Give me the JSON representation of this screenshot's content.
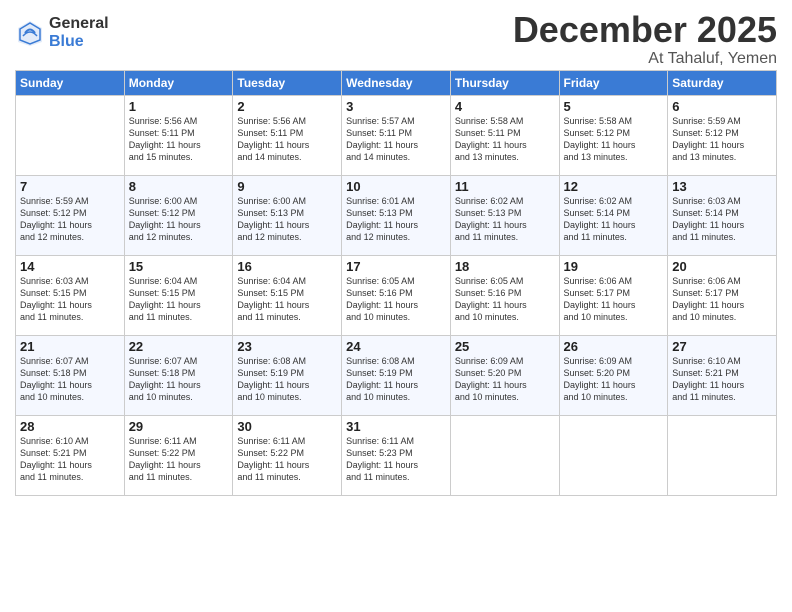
{
  "logo": {
    "general": "General",
    "blue": "Blue"
  },
  "title": "December 2025",
  "location": "At Tahaluf, Yemen",
  "days_of_week": [
    "Sunday",
    "Monday",
    "Tuesday",
    "Wednesday",
    "Thursday",
    "Friday",
    "Saturday"
  ],
  "weeks": [
    [
      {
        "day": "",
        "info": ""
      },
      {
        "day": "1",
        "info": "Sunrise: 5:56 AM\nSunset: 5:11 PM\nDaylight: 11 hours\nand 15 minutes."
      },
      {
        "day": "2",
        "info": "Sunrise: 5:56 AM\nSunset: 5:11 PM\nDaylight: 11 hours\nand 14 minutes."
      },
      {
        "day": "3",
        "info": "Sunrise: 5:57 AM\nSunset: 5:11 PM\nDaylight: 11 hours\nand 14 minutes."
      },
      {
        "day": "4",
        "info": "Sunrise: 5:58 AM\nSunset: 5:11 PM\nDaylight: 11 hours\nand 13 minutes."
      },
      {
        "day": "5",
        "info": "Sunrise: 5:58 AM\nSunset: 5:12 PM\nDaylight: 11 hours\nand 13 minutes."
      },
      {
        "day": "6",
        "info": "Sunrise: 5:59 AM\nSunset: 5:12 PM\nDaylight: 11 hours\nand 13 minutes."
      }
    ],
    [
      {
        "day": "7",
        "info": "Sunrise: 5:59 AM\nSunset: 5:12 PM\nDaylight: 11 hours\nand 12 minutes."
      },
      {
        "day": "8",
        "info": "Sunrise: 6:00 AM\nSunset: 5:12 PM\nDaylight: 11 hours\nand 12 minutes."
      },
      {
        "day": "9",
        "info": "Sunrise: 6:00 AM\nSunset: 5:13 PM\nDaylight: 11 hours\nand 12 minutes."
      },
      {
        "day": "10",
        "info": "Sunrise: 6:01 AM\nSunset: 5:13 PM\nDaylight: 11 hours\nand 12 minutes."
      },
      {
        "day": "11",
        "info": "Sunrise: 6:02 AM\nSunset: 5:13 PM\nDaylight: 11 hours\nand 11 minutes."
      },
      {
        "day": "12",
        "info": "Sunrise: 6:02 AM\nSunset: 5:14 PM\nDaylight: 11 hours\nand 11 minutes."
      },
      {
        "day": "13",
        "info": "Sunrise: 6:03 AM\nSunset: 5:14 PM\nDaylight: 11 hours\nand 11 minutes."
      }
    ],
    [
      {
        "day": "14",
        "info": "Sunrise: 6:03 AM\nSunset: 5:15 PM\nDaylight: 11 hours\nand 11 minutes."
      },
      {
        "day": "15",
        "info": "Sunrise: 6:04 AM\nSunset: 5:15 PM\nDaylight: 11 hours\nand 11 minutes."
      },
      {
        "day": "16",
        "info": "Sunrise: 6:04 AM\nSunset: 5:15 PM\nDaylight: 11 hours\nand 11 minutes."
      },
      {
        "day": "17",
        "info": "Sunrise: 6:05 AM\nSunset: 5:16 PM\nDaylight: 11 hours\nand 10 minutes."
      },
      {
        "day": "18",
        "info": "Sunrise: 6:05 AM\nSunset: 5:16 PM\nDaylight: 11 hours\nand 10 minutes."
      },
      {
        "day": "19",
        "info": "Sunrise: 6:06 AM\nSunset: 5:17 PM\nDaylight: 11 hours\nand 10 minutes."
      },
      {
        "day": "20",
        "info": "Sunrise: 6:06 AM\nSunset: 5:17 PM\nDaylight: 11 hours\nand 10 minutes."
      }
    ],
    [
      {
        "day": "21",
        "info": "Sunrise: 6:07 AM\nSunset: 5:18 PM\nDaylight: 11 hours\nand 10 minutes."
      },
      {
        "day": "22",
        "info": "Sunrise: 6:07 AM\nSunset: 5:18 PM\nDaylight: 11 hours\nand 10 minutes."
      },
      {
        "day": "23",
        "info": "Sunrise: 6:08 AM\nSunset: 5:19 PM\nDaylight: 11 hours\nand 10 minutes."
      },
      {
        "day": "24",
        "info": "Sunrise: 6:08 AM\nSunset: 5:19 PM\nDaylight: 11 hours\nand 10 minutes."
      },
      {
        "day": "25",
        "info": "Sunrise: 6:09 AM\nSunset: 5:20 PM\nDaylight: 11 hours\nand 10 minutes."
      },
      {
        "day": "26",
        "info": "Sunrise: 6:09 AM\nSunset: 5:20 PM\nDaylight: 11 hours\nand 10 minutes."
      },
      {
        "day": "27",
        "info": "Sunrise: 6:10 AM\nSunset: 5:21 PM\nDaylight: 11 hours\nand 11 minutes."
      }
    ],
    [
      {
        "day": "28",
        "info": "Sunrise: 6:10 AM\nSunset: 5:21 PM\nDaylight: 11 hours\nand 11 minutes."
      },
      {
        "day": "29",
        "info": "Sunrise: 6:11 AM\nSunset: 5:22 PM\nDaylight: 11 hours\nand 11 minutes."
      },
      {
        "day": "30",
        "info": "Sunrise: 6:11 AM\nSunset: 5:22 PM\nDaylight: 11 hours\nand 11 minutes."
      },
      {
        "day": "31",
        "info": "Sunrise: 6:11 AM\nSunset: 5:23 PM\nDaylight: 11 hours\nand 11 minutes."
      },
      {
        "day": "",
        "info": ""
      },
      {
        "day": "",
        "info": ""
      },
      {
        "day": "",
        "info": ""
      }
    ]
  ]
}
